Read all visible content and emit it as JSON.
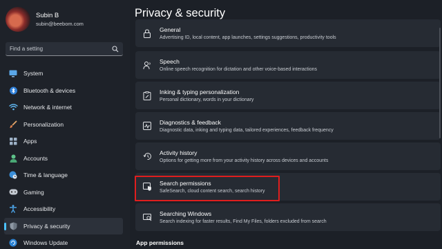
{
  "profile": {
    "name": "Subin B",
    "email": "subin@beebom.com"
  },
  "search": {
    "placeholder": "Find a setting",
    "icon": "search-icon"
  },
  "sidebar": {
    "items": [
      {
        "label": "System",
        "icon": "monitor-icon",
        "active": false
      },
      {
        "label": "Bluetooth & devices",
        "icon": "bluetooth-icon",
        "active": false
      },
      {
        "label": "Network & internet",
        "icon": "wifi-icon",
        "active": false
      },
      {
        "label": "Personalization",
        "icon": "brush-icon",
        "active": false
      },
      {
        "label": "Apps",
        "icon": "apps-icon",
        "active": false
      },
      {
        "label": "Accounts",
        "icon": "person-icon",
        "active": false
      },
      {
        "label": "Time & language",
        "icon": "globe-clock-icon",
        "active": false
      },
      {
        "label": "Gaming",
        "icon": "gamepad-icon",
        "active": false
      },
      {
        "label": "Accessibility",
        "icon": "accessibility-icon",
        "active": false
      },
      {
        "label": "Privacy & security",
        "icon": "shield-icon",
        "active": true
      },
      {
        "label": "Windows Update",
        "icon": "update-icon",
        "active": false
      }
    ]
  },
  "main": {
    "title": "Privacy & security",
    "cards": [
      {
        "title": "General",
        "desc": "Advertising ID, local content, app launches, settings suggestions, productivity tools",
        "icon": "lock-icon"
      },
      {
        "title": "Speech",
        "desc": "Online speech recognition for dictation and other voice-based interactions",
        "icon": "speech-icon"
      },
      {
        "title": "Inking & typing personalization",
        "desc": "Personal dictionary, words in your dictionary",
        "icon": "clipboard-pen-icon"
      },
      {
        "title": "Diagnostics & feedback",
        "desc": "Diagnostic data, inking and typing data, tailored experiences, feedback frequency",
        "icon": "diagnostics-icon"
      },
      {
        "title": "Activity history",
        "desc": "Options for getting more from your activity history across devices and accounts",
        "icon": "history-icon"
      },
      {
        "title": "Search permissions",
        "desc": "SafeSearch, cloud content search, search history",
        "icon": "search-permissions-icon"
      },
      {
        "title": "Searching Windows",
        "desc": "Search indexing for faster results, Find My Files, folders excluded from search",
        "icon": "search-windows-icon"
      }
    ],
    "section_label": "App permissions"
  },
  "colors": {
    "accent": "#4cc2ff",
    "highlight": "#e01e1e",
    "background": "#1c2027",
    "card": "#262b33"
  }
}
